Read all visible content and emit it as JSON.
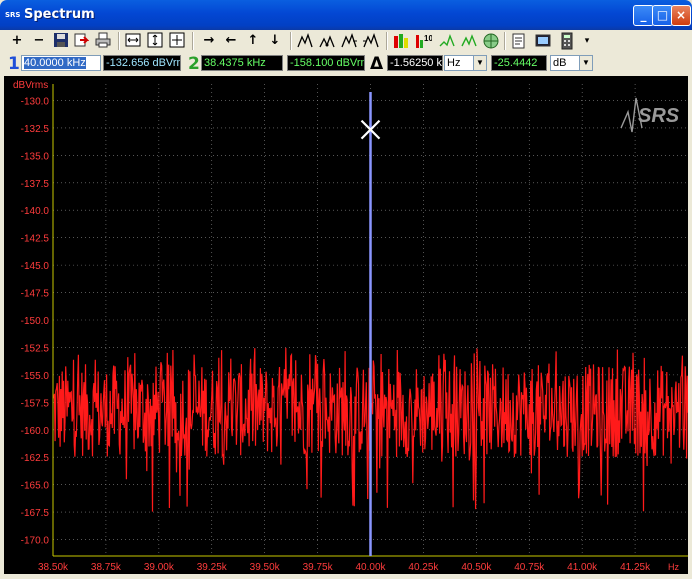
{
  "window": {
    "title": "Spectrum",
    "logo_text": "SRS",
    "controls": [
      "_",
      "□",
      "×"
    ]
  },
  "toolbar": {
    "icons": [
      "zoom-in-icon",
      "zoom-out-icon",
      "save-icon",
      "export-icon",
      "print-icon",
      "fit-horizontal-icon",
      "fit-vertical-icon",
      "fit-all-icon",
      "pan-right-icon",
      "pan-left-icon",
      "pan-up-icon",
      "pan-down-icon",
      "cursor-find-max-icon",
      "cursor-find-min-icon",
      "cursor-peak-right-icon",
      "cursor-peak-left-icon",
      "bar-chart-icon",
      "harmonics-icon",
      "marker-up-icon",
      "marker-down-icon",
      "target-icon",
      "notes-icon",
      "display-icon",
      "calculator-icon",
      "dropdown-icon"
    ],
    "labels": {
      "zoom_in": "+",
      "zoom_out": "−",
      "pan_right": "→",
      "pan_left": "←",
      "pan_up": "↑",
      "pan_down": "↓",
      "more": "▾"
    }
  },
  "readouts": {
    "cursor1": {
      "label": "1",
      "x_value": "40.0000 kHz",
      "y_value": "-132.656 dBVrm"
    },
    "cursor2": {
      "label": "2",
      "x_value": "38.4375 kHz",
      "y_value": "-158.100 dBVrm"
    },
    "delta": {
      "label": "Δ",
      "x_value": "-1.56250 k",
      "x_unit": "Hz",
      "y_value": "-25.4442",
      "y_unit": "dB"
    }
  },
  "colors": {
    "plot_bg": "#000000",
    "trace": "#ff1a1a",
    "axis_text": "#ff3c3c",
    "axis_line": "#c8c800",
    "cursor_line": "#8a96ff",
    "grid": "#8a8a8a",
    "cursor1_num": "#1f4fd8",
    "cursor2_num": "#2aa02a",
    "readout_y1_text": "#5ac8ff",
    "readout_green_text": "#66ff66"
  },
  "chart_data": {
    "type": "line",
    "ylabel": "dBVrms",
    "xlabel": "Hz",
    "xlim": [
      38.5,
      41.5
    ],
    "ylim": [
      -171.5,
      -128.5
    ],
    "x_ticks": [
      "38.50k",
      "38.75k",
      "39.00k",
      "39.25k",
      "39.50k",
      "39.75k",
      "40.00k",
      "40.25k",
      "40.50k",
      "40.75k",
      "41.00k",
      "41.25k"
    ],
    "x_tick_values": [
      38.5,
      38.75,
      39.0,
      39.25,
      39.5,
      39.75,
      40.0,
      40.25,
      40.5,
      40.75,
      41.0,
      41.25
    ],
    "y_ticks": [
      "-130.0",
      "-132.5",
      "-135.0",
      "-137.5",
      "-140.0",
      "-142.5",
      "-145.0",
      "-147.5",
      "-150.0",
      "-152.5",
      "-155.0",
      "-157.5",
      "-160.0",
      "-162.5",
      "-165.0",
      "-167.5",
      "-170.0"
    ],
    "y_tick_values": [
      -130,
      -132.5,
      -135,
      -137.5,
      -140,
      -142.5,
      -145,
      -147.5,
      -150,
      -152.5,
      -155,
      -157.5,
      -160,
      -162.5,
      -165,
      -167.5,
      -170
    ],
    "noise_floor": {
      "mean": -158.0,
      "upper_envelope": -154.0,
      "lower_envelope": -162.5,
      "max_spike": -152.5,
      "min_spike": -167.5
    },
    "cursor_x": 40.0,
    "marker": {
      "x": 40.0,
      "y": -132.656
    },
    "grid": true,
    "watermark": "SRS"
  }
}
